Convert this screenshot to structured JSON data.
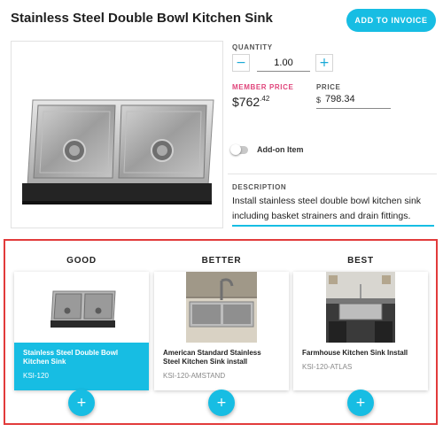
{
  "product": {
    "title": "Stainless Steel Double Bowl Kitchen Sink",
    "add_invoice_label": "ADD TO INVOICE",
    "image_icon": "double-bowl-sink-image"
  },
  "quantity": {
    "label": "QUANTITY",
    "value": "1.00",
    "decrement_symbol": "−",
    "increment_symbol": "+"
  },
  "pricing": {
    "member_label": "MEMBER PRICE",
    "member_dollars": "$762",
    "member_cents": ".42",
    "price_label": "PRICE",
    "currency_symbol": "$",
    "price_value": "798.34"
  },
  "addon": {
    "label": "Add-on Item",
    "enabled": false
  },
  "description": {
    "label": "DESCRIPTION",
    "text": "Install stainless steel double bowl kitchen sink including basket strainers and drain fittings."
  },
  "tiers": [
    {
      "heading": "GOOD",
      "name": "Stainless Steel Double Bowl Kitchen Sink",
      "sku": "KSI-120",
      "selected": true,
      "add_symbol": "+"
    },
    {
      "heading": "BETTER",
      "name": "American Standard Stainless Steel Kitchen Sink install",
      "sku": "KSI-120-AMSTAND",
      "selected": false,
      "add_symbol": "+"
    },
    {
      "heading": "BEST",
      "name": "Farmhouse Kitchen Sink Install",
      "sku": "KSI-120-ATLAS",
      "selected": false,
      "add_symbol": "+"
    }
  ],
  "colors": {
    "accent": "#17bde3",
    "member_price": "#e0457b",
    "highlight_border": "#e23b3b"
  }
}
